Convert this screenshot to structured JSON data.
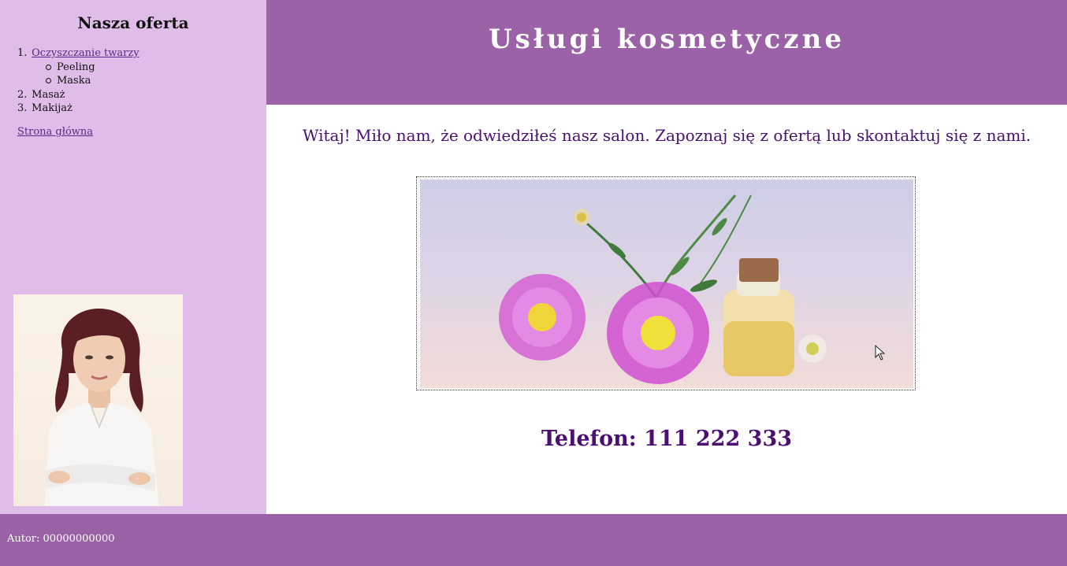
{
  "sidebar": {
    "title": "Nasza oferta",
    "items": [
      {
        "num": "1.",
        "label": "Oczyszczanie twarzy",
        "sub": [
          "Peeling",
          "Maska"
        ]
      },
      {
        "num": "2.",
        "label": "Masaż"
      },
      {
        "num": "3.",
        "label": "Makijaż"
      }
    ],
    "home_link": "Strona główna"
  },
  "header": {
    "title": "Usługi kosmetyczne"
  },
  "main": {
    "welcome": "Witaj! Miło nam, że odwiedziłeś nasz salon. Zapoznaj się z ofertą lub skontaktuj się z nami.",
    "phone": "Telefon: 111 222 333"
  },
  "footer": {
    "author": "Autor: 00000000000"
  },
  "colors": {
    "sidebar_bg": "#e0bce8",
    "header_bg": "#9b62a8",
    "accent_text": "#4b0f72",
    "link": "#5b2a86"
  }
}
